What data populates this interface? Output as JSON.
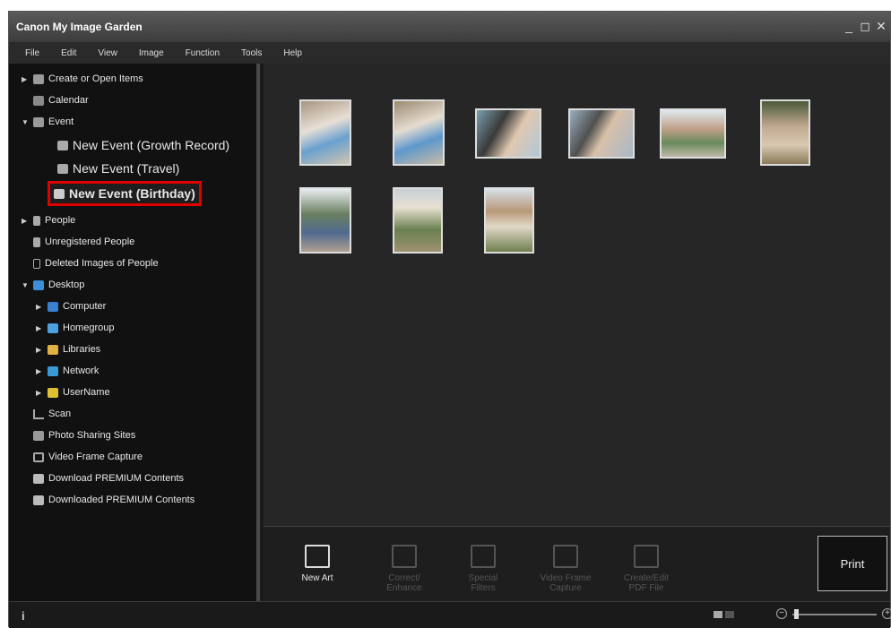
{
  "app": {
    "title": "Canon My Image Garden",
    "window_controls": [
      "_",
      "◻",
      "✕"
    ]
  },
  "menu": [
    "File",
    "Edit",
    "View",
    "Image",
    "Function",
    "Tools",
    "Help"
  ],
  "tree": [
    {
      "label": "Create or Open Items",
      "icon": "create-items-icon"
    },
    {
      "label": "Calendar",
      "icon": "calendar-icon"
    },
    {
      "label": "Event",
      "icon": "event-icon"
    },
    {
      "label": "New Event (Growth Record)",
      "icon": "growth-record-icon"
    },
    {
      "label": "New Event (Travel)",
      "icon": "travel-icon"
    },
    {
      "label": "New Event (Birthday)",
      "icon": "birthday-icon"
    },
    {
      "label": "People",
      "icon": "people-icon"
    },
    {
      "label": "Unregistered People",
      "icon": "unregistered-people-icon"
    },
    {
      "label": "Deleted Images of People",
      "icon": "deleted-people-icon"
    },
    {
      "label": "Desktop",
      "icon": "desktop-icon"
    },
    {
      "label": "Computer",
      "icon": "computer-icon"
    },
    {
      "label": "Homegroup",
      "icon": "homegroup-icon"
    },
    {
      "label": "Libraries",
      "icon": "libraries-icon"
    },
    {
      "label": "Network",
      "icon": "network-icon"
    },
    {
      "label": "UserName",
      "icon": "user-folder-icon"
    },
    {
      "label": "Scan",
      "icon": "scan-icon"
    },
    {
      "label": "Photo Sharing Sites",
      "icon": "photo-sharing-icon"
    },
    {
      "label": "Video Frame Capture",
      "icon": "video-frame-icon"
    },
    {
      "label": "Download PREMIUM Contents",
      "icon": "download-premium-icon"
    },
    {
      "label": "Downloaded PREMIUM Contents",
      "icon": "downloaded-premium-icon"
    }
  ],
  "toolbar": {
    "new_art": "New Art",
    "correct_enhance_1": "Correct/",
    "correct_enhance_2": "Enhance",
    "special_filters_1": "Special",
    "special_filters_2": "Filters",
    "video_frame_1": "Video Frame",
    "video_frame_2": "Capture",
    "create_pdf_1": "Create/Edit",
    "create_pdf_2": "PDF File",
    "print": "Print"
  },
  "status": {
    "info": "i",
    "zoom_minus": "−",
    "zoom_plus": "+"
  }
}
